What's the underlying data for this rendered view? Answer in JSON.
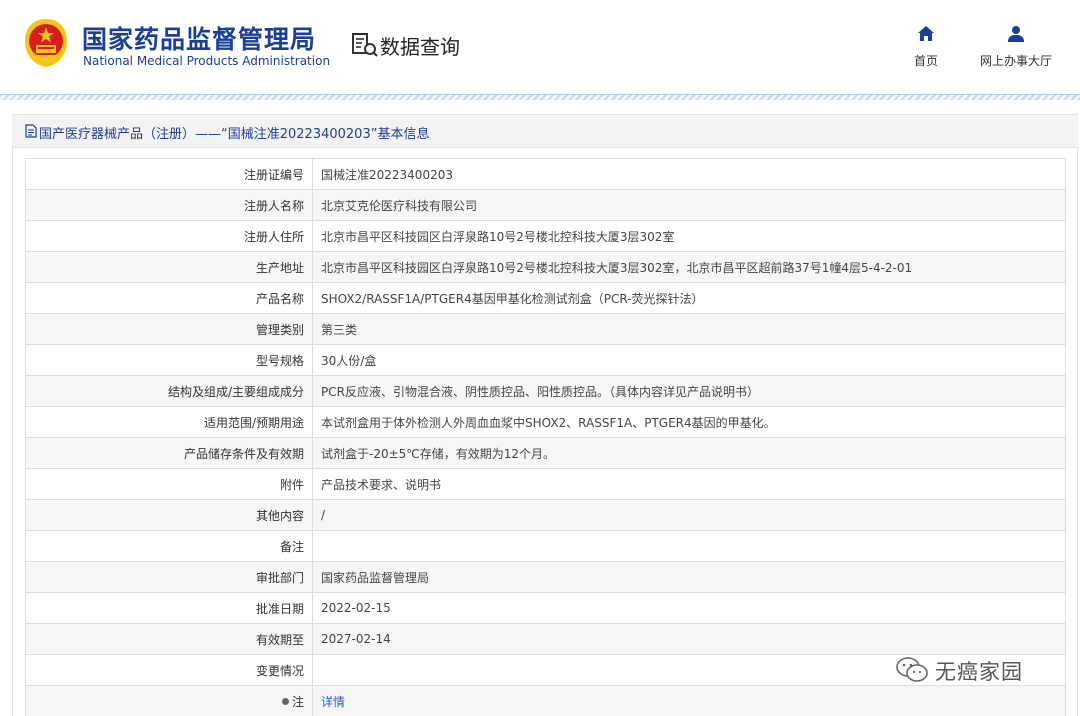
{
  "header": {
    "org_name_cn": "国家药品监督管理局",
    "org_name_en": "National Medical Products Administration",
    "section_title": "数据查询",
    "nav": [
      {
        "label": "首页",
        "icon": "home-icon"
      },
      {
        "label": "网上办事大厅",
        "icon": "user-icon"
      }
    ]
  },
  "breadcrumb": {
    "text": "国产医疗器械产品（注册）——“国械注准20223400203”基本信息"
  },
  "rows": [
    {
      "key": "注册证编号",
      "value": "国械注准20223400203"
    },
    {
      "key": "注册人名称",
      "value": "北京艾克伦医疗科技有限公司"
    },
    {
      "key": "注册人住所",
      "value": "北京市昌平区科技园区白浮泉路10号2号楼北控科技大厦3层302室"
    },
    {
      "key": "生产地址",
      "value": "北京市昌平区科技园区白浮泉路10号2号楼北控科技大厦3层302室，北京市昌平区超前路37号1幢4层5-4-2-01"
    },
    {
      "key": "产品名称",
      "value": "SHOX2/RASSF1A/PTGER4基因甲基化检测试剂盒（PCR-荧光探针法）"
    },
    {
      "key": "管理类别",
      "value": "第三类"
    },
    {
      "key": "型号规格",
      "value": "30人份/盒"
    },
    {
      "key": "结构及组成/主要组成成分",
      "value": "PCR反应液、引物混合液、阴性质控品、阳性质控品。（具体内容详见产品说明书）"
    },
    {
      "key": "适用范围/预期用途",
      "value": "本试剂盒用于体外检测人外周血血浆中SHOX2、RASSF1A、PTGER4基因的甲基化。"
    },
    {
      "key": "产品储存条件及有效期",
      "value": "试剂盒于-20±5℃存储，有效期为12个月。"
    },
    {
      "key": "附件",
      "value": "产品技术要求、说明书"
    },
    {
      "key": "其他内容",
      "value": "/"
    },
    {
      "key": "备注",
      "value": ""
    },
    {
      "key": "审批部门",
      "value": "国家药品监督管理局"
    },
    {
      "key": "批准日期",
      "value": "2022-02-15"
    },
    {
      "key": "有效期至",
      "value": "2027-02-14"
    },
    {
      "key": "变更情况",
      "value": ""
    }
  ],
  "note_row": {
    "key": "注",
    "link_label": "详情"
  },
  "watermark": {
    "text": "无癌家园",
    "icon": "wechat-icon"
  },
  "colors": {
    "brand_blue": "#1b3f95",
    "link_blue": "#2a63c7",
    "emblem_red": "#d71d1d",
    "emblem_gold": "#f5c518"
  }
}
